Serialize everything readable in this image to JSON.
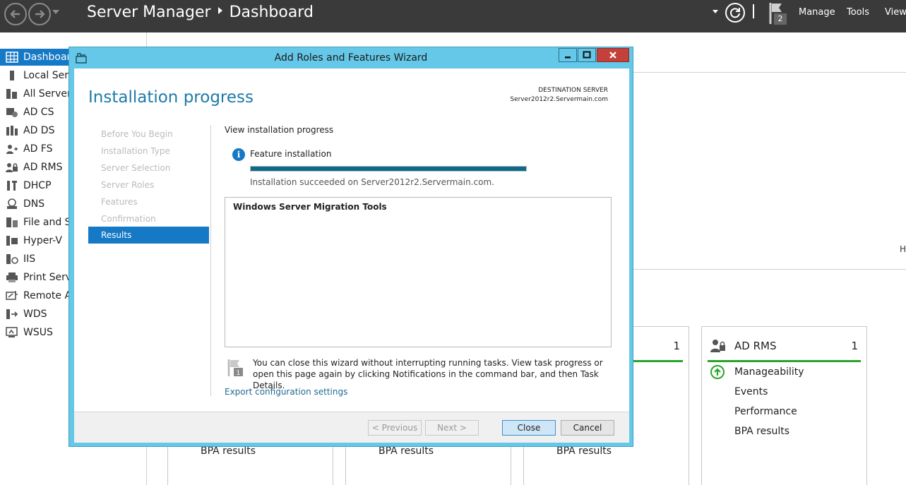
{
  "app": {
    "title": "Server Manager",
    "page": "Dashboard",
    "notification_count": "2",
    "menu": [
      "Manage",
      "Tools",
      "View"
    ]
  },
  "sidebar": {
    "items": [
      {
        "label": "Dashboard",
        "icon": "dashboard-icon",
        "active": true
      },
      {
        "label": "Local Server",
        "icon": "local-server-icon"
      },
      {
        "label": "All Servers",
        "icon": "all-servers-icon"
      },
      {
        "label": "AD CS",
        "icon": "certificate-icon"
      },
      {
        "label": "AD DS",
        "icon": "directory-icon"
      },
      {
        "label": "AD FS",
        "icon": "federation-icon"
      },
      {
        "label": "AD RMS",
        "icon": "rights-icon"
      },
      {
        "label": "DHCP",
        "icon": "dhcp-icon"
      },
      {
        "label": "DNS",
        "icon": "dns-icon"
      },
      {
        "label": "File and Storage Services",
        "icon": "file-storage-icon"
      },
      {
        "label": "Hyper-V",
        "icon": "hyperv-icon"
      },
      {
        "label": "IIS",
        "icon": "iis-icon"
      },
      {
        "label": "Print Services",
        "icon": "printer-icon"
      },
      {
        "label": "Remote Access",
        "icon": "remote-access-icon"
      },
      {
        "label": "WDS",
        "icon": "wds-icon"
      },
      {
        "label": "WSUS",
        "icon": "wsus-icon"
      }
    ]
  },
  "background": {
    "h_char": "H",
    "tiles": [
      {
        "title": "",
        "count": "",
        "rows": [
          "BPA results"
        ]
      },
      {
        "title": "",
        "count": "",
        "rows": [
          "BPA results"
        ]
      },
      {
        "title": "",
        "count": "1",
        "rows": [
          "BPA results"
        ]
      },
      {
        "title": "AD RMS",
        "count": "1",
        "rows": [
          "Manageability",
          "Events",
          "Performance",
          "BPA results"
        ]
      }
    ]
  },
  "wizard": {
    "title": "Add Roles and Features Wizard",
    "heading": "Installation progress",
    "destination_label": "DESTINATION SERVER",
    "destination_server": "Server2012r2.Servermain.com",
    "steps": [
      "Before You Begin",
      "Installation Type",
      "Server Selection",
      "Server Roles",
      "Features",
      "Confirmation",
      "Results"
    ],
    "active_step": "Results",
    "section_title": "View installation progress",
    "feature_label": "Feature installation",
    "progress": 1.0,
    "succeeded_text": "Installation succeeded on Server2012r2.Servermain.com.",
    "results_item": "Windows Server Migration Tools",
    "note_flag_count": "1",
    "note_text": "You can close this wizard without interrupting running tasks. View task progress or open this page again by clicking Notifications in the command bar, and then Task Details.",
    "export_link": "Export configuration settings",
    "buttons": {
      "previous": "< Previous",
      "next": "Next >",
      "close": "Close",
      "cancel": "Cancel"
    }
  },
  "colors": {
    "accent": "#1679c5",
    "header_bg": "#3a3a3a",
    "wizard_frame": "#66c8e8",
    "heading": "#1e7aa8",
    "status_ok": "#2aa52a",
    "progress_fill": "#0e6a8a"
  }
}
